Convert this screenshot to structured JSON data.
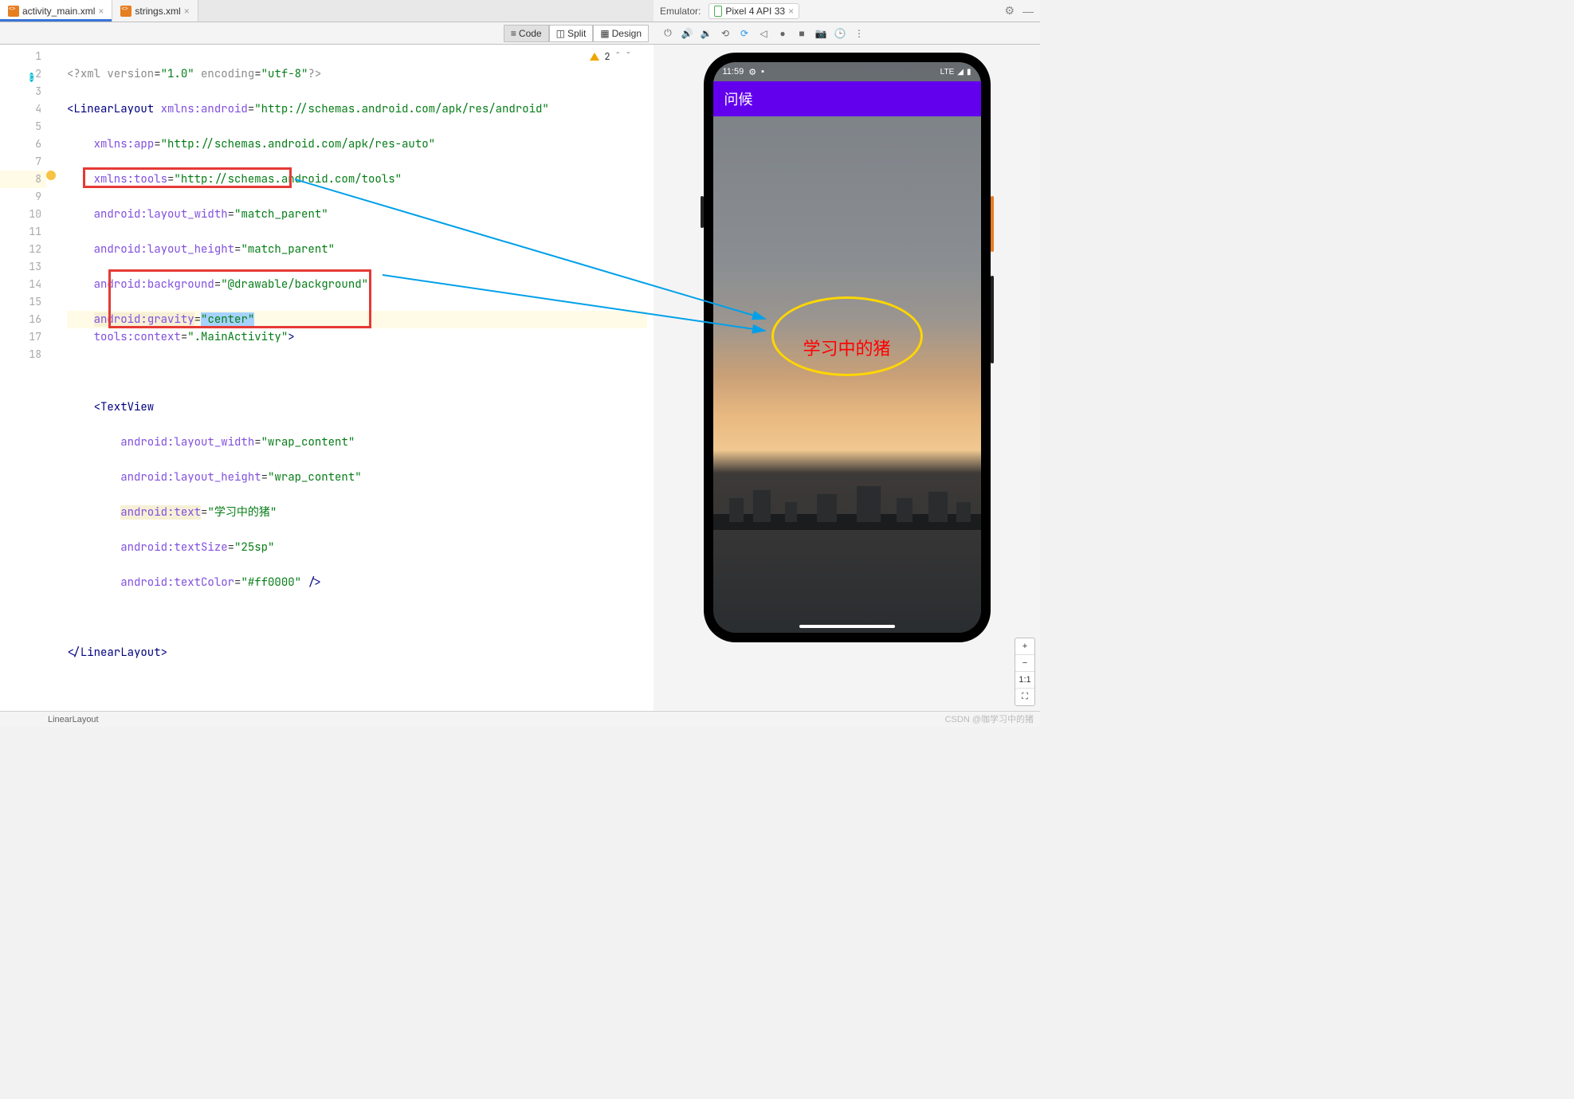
{
  "tabs": {
    "left": [
      {
        "label": "activity_main.xml",
        "active": true
      },
      {
        "label": "strings.xml",
        "active": false
      }
    ]
  },
  "emulator": {
    "label": "Emulator:",
    "device": "Pixel 4 API 33"
  },
  "viewModes": {
    "code": "Code",
    "split": "Split",
    "design": "Design"
  },
  "warnings": {
    "count": "2"
  },
  "code": {
    "l1_a": "<?",
    "l1_b": "xml version",
    "l1_c": "=",
    "l1_d": "\"1.0\"",
    "l1_e": " encoding",
    "l1_f": "=",
    "l1_g": "\"utf-8\"",
    "l1_h": "?>",
    "l2_a": "<",
    "l2_b": "LinearLayout ",
    "l2_c": "xmlns:",
    "l2_d": "android",
    "l2_e": "=",
    "l2_f": "\"http://schemas.android.com/apk/res/android\"",
    "l3_a": "    ",
    "l3_b": "xmlns:",
    "l3_c": "app",
    "l3_d": "=",
    "l3_e": "\"http://schemas.android.com/apk/res-auto\"",
    "l4_a": "    ",
    "l4_b": "xmlns:",
    "l4_c": "tools",
    "l4_d": "=",
    "l4_e": "\"http://schemas.android.com/tools\"",
    "l5_a": "    ",
    "l5_b": "android",
    ":": ":",
    "l5_c": "layout_width",
    "l5_d": "=",
    "l5_e": "\"match_parent\"",
    "l6_a": "    ",
    "l6_b": "android",
    "l6_c": "layout_height",
    "l6_d": "=",
    "l6_e": "\"match_parent\"",
    "l7_a": "    ",
    "l7_b": "android",
    "l7_c": "background",
    "l7_d": "=",
    "l7_e": "\"@drawable/background\"",
    "l8_a": "    ",
    "l8_b": "android",
    "l8_c": "gravity",
    "l8_d": "=",
    "l8_e": "\"",
    "l8_f": "center",
    "l8_g": "\"",
    "l9_a": "    ",
    "l9_b": "tools",
    "l9_c": "context",
    "l9_d": "=",
    "l9_e": "\".MainActivity\"",
    "l9_f": ">",
    "l11_a": "    <",
    "l11_b": "TextView",
    "l12_a": "        ",
    "l12_b": "android",
    "l12_c": "layout_width",
    "l12_d": "=",
    "l12_e": "\"wrap_content\"",
    "l13_a": "        ",
    "l13_b": "android",
    "l13_c": "layout_height",
    "l13_d": "=",
    "l13_e": "\"wrap_content\"",
    "l14_a": "        ",
    "l14_b": "android",
    "l14_c": "text",
    "l14_d": "=",
    "l14_e": "\"学习中的猪\"",
    "l15_a": "        ",
    "l15_b": "android",
    "l15_c": "textSize",
    "l15_d": "=",
    "l15_e": "\"25sp\"",
    "l16_a": "        ",
    "l16_b": "android",
    "l16_c": "textColor",
    "l16_d": "=",
    "l16_e": "\"#ff0000\"",
    "l16_f": " />",
    "l18_a": "</",
    "l18_b": "LinearLayout",
    "l18_c": ">"
  },
  "phone": {
    "time": "11:59",
    "lte": "LTE",
    "appTitle": "问候",
    "centerText": "学习中的猪"
  },
  "zoom": {
    "plus": "+",
    "minus": "−",
    "fit": "1:1",
    "full": "⛶"
  },
  "breadcrumb": "LinearLayout",
  "watermark": "CSDN @咖学习中的猪"
}
